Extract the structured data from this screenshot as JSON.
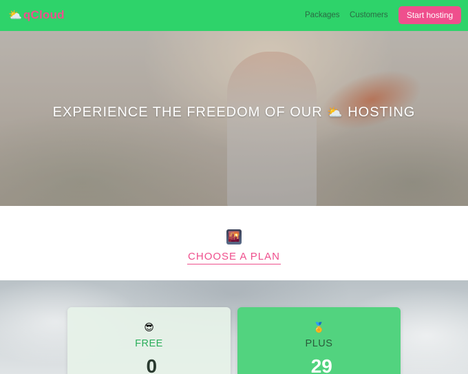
{
  "header": {
    "logo_text": "qCloud",
    "logo_icon": "sun-behind-cloud-icon",
    "nav": [
      {
        "label": "Packages"
      },
      {
        "label": "Customers"
      }
    ],
    "cta_label": "Start hosting"
  },
  "hero": {
    "title_before": "EXPERIENCE THE FREEDOM OF OUR",
    "title_icon": "⛅",
    "title_after": "HOSTING"
  },
  "choose": {
    "icon": "sunset-city-icon",
    "title": "CHOOSE A PLAN"
  },
  "plans": [
    {
      "emoji": "😎",
      "name": "FREE",
      "currency": "$",
      "price": "0"
    },
    {
      "emoji": "🏅",
      "name": "PLUS",
      "currency": "$",
      "price": "29"
    }
  ],
  "colors": {
    "header_bg": "#2ed36a",
    "accent_pink": "#ef4f8d",
    "plus_card_bg": "#52d37f"
  }
}
